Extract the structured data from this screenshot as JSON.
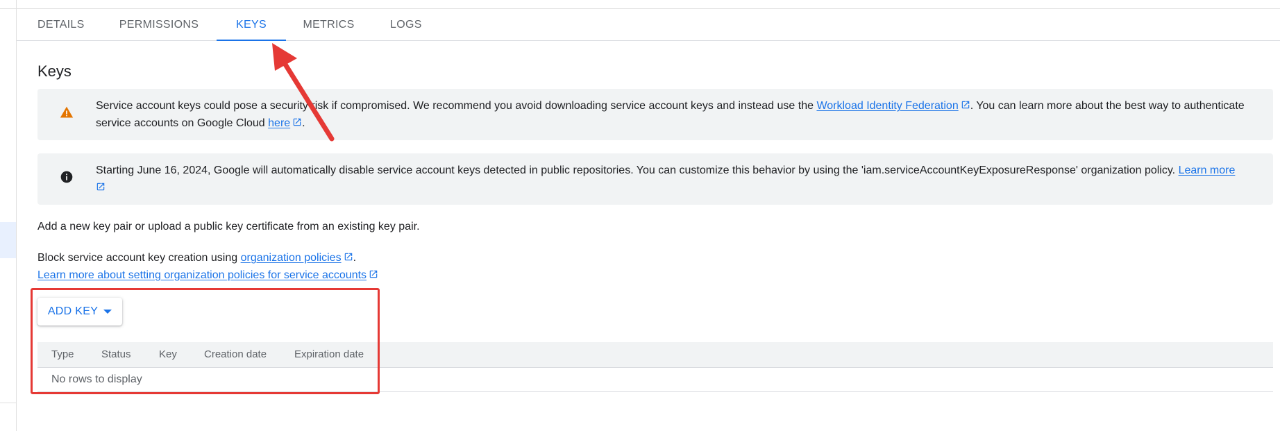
{
  "tabs": [
    {
      "label": "DETAILS"
    },
    {
      "label": "PERMISSIONS"
    },
    {
      "label": "KEYS"
    },
    {
      "label": "METRICS"
    },
    {
      "label": "LOGS"
    }
  ],
  "active_tab": "KEYS",
  "section_title": "Keys",
  "warning_banner": {
    "icon": "warning-icon",
    "text_1": "Service account keys could pose a security risk if compromised. We recommend you avoid downloading service account keys and instead use the ",
    "link_1": "Workload Identity Federation",
    "text_2": ". You can learn more about the best way to authenticate service accounts on Google Cloud ",
    "link_2": "here",
    "text_3": "."
  },
  "info_banner": {
    "icon": "info-icon",
    "text_1": "Starting June 16, 2024, Google will automatically disable service account keys detected in public repositories. You can customize this behavior by using the 'iam.serviceAccountKeyExposureResponse' organization policy. ",
    "link_1": "Learn more"
  },
  "intro_text": "Add a new key pair or upload a public key certificate from an existing key pair.",
  "policy": {
    "text": "Block service account key creation using ",
    "link": "organization policies",
    "period": ".",
    "learn_link": "Learn more about setting organization policies for service accounts"
  },
  "add_key_label": "ADD KEY",
  "table": {
    "columns": [
      "Type",
      "Status",
      "Key",
      "Creation date",
      "Expiration date"
    ],
    "empty_text": "No rows to display"
  },
  "colors": {
    "accent": "#1a73e8",
    "warning": "#e37400",
    "annotation": "#e53935"
  }
}
